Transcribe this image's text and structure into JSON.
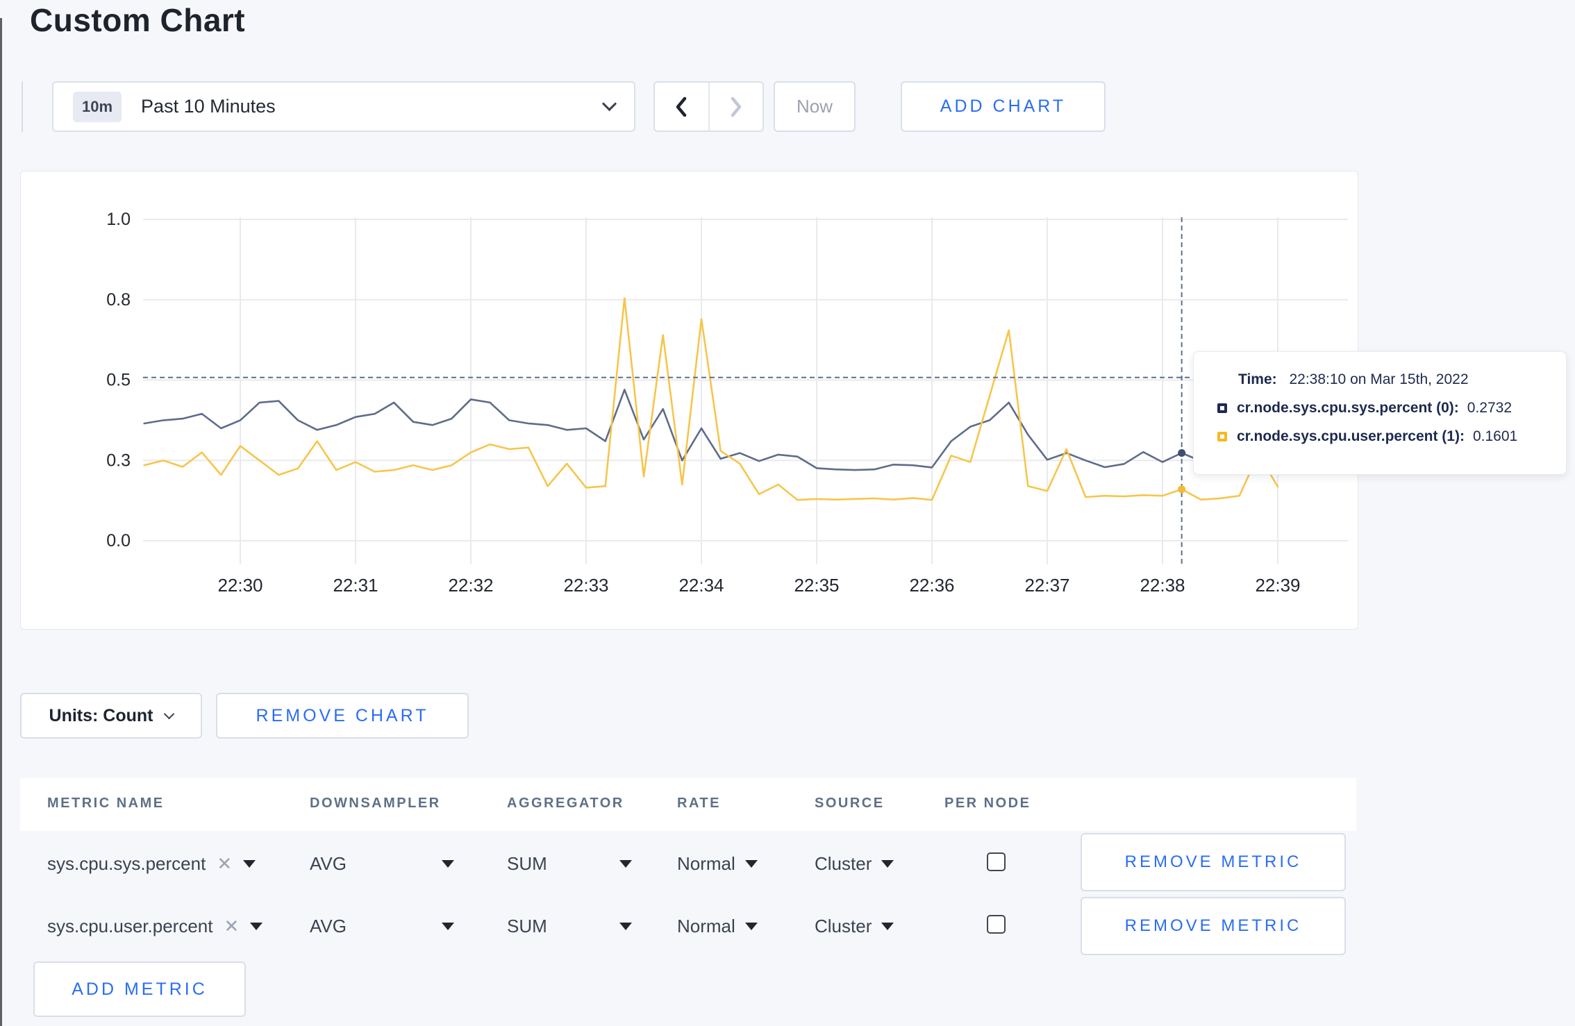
{
  "page_title": "Custom Chart",
  "colors": {
    "accent_blue": "#2a6df4",
    "series_sys": "#5e6c8a",
    "series_user": "#f6c64b",
    "tooltip_sys_square": "#1e2b52",
    "tooltip_user_square": "#f5b921",
    "crosshair": "#5d6f8a",
    "grid": "#e9eaee"
  },
  "toolbar": {
    "time_badge": "10m",
    "time_label": "Past 10 Minutes",
    "now_label": "Now",
    "add_chart_label": "ADD CHART"
  },
  "chart_data": {
    "type": "line",
    "title": "",
    "xlabel": "",
    "ylabel": "",
    "ylim": [
      0,
      1
    ],
    "grid": true,
    "legend_position": "tooltip",
    "x_ticks": [
      "22:30",
      "22:31",
      "22:32",
      "22:33",
      "22:34",
      "22:35",
      "22:36",
      "22:37",
      "22:38",
      "22:39"
    ],
    "y_ticks": [
      {
        "label": "0.0",
        "value": 0
      },
      {
        "label": "0.3",
        "value": 0.25
      },
      {
        "label": "0.5",
        "value": 0.5
      },
      {
        "label": "0.8",
        "value": 0.75
      },
      {
        "label": "1.0",
        "value": 1
      }
    ],
    "start_time": "22:29:10",
    "interval_seconds": 10,
    "x_start_minutes": -0.8333,
    "series": [
      {
        "name": "cr.node.sys.cpu.sys.percent",
        "color": "#5e6c8a",
        "values": [
          0.365,
          0.375,
          0.38,
          0.395,
          0.35,
          0.375,
          0.43,
          0.435,
          0.375,
          0.345,
          0.36,
          0.385,
          0.395,
          0.43,
          0.37,
          0.36,
          0.38,
          0.44,
          0.43,
          0.375,
          0.365,
          0.36,
          0.345,
          0.35,
          0.31,
          0.47,
          0.315,
          0.41,
          0.25,
          0.35,
          0.255,
          0.273,
          0.248,
          0.268,
          0.262,
          0.226,
          0.222,
          0.22,
          0.222,
          0.237,
          0.235,
          0.228,
          0.31,
          0.355,
          0.375,
          0.43,
          0.33,
          0.252,
          0.273,
          0.25,
          0.229,
          0.239,
          0.276,
          0.245,
          0.2732,
          0.248,
          0.26,
          0.27,
          0.26,
          0.25
        ]
      },
      {
        "name": "cr.node.sys.cpu.user.percent",
        "color": "#f6c64b",
        "values": [
          0.235,
          0.25,
          0.23,
          0.275,
          0.205,
          0.295,
          0.25,
          0.205,
          0.225,
          0.31,
          0.22,
          0.245,
          0.215,
          0.22,
          0.235,
          0.22,
          0.235,
          0.275,
          0.3,
          0.285,
          0.29,
          0.17,
          0.24,
          0.165,
          0.17,
          0.755,
          0.2,
          0.64,
          0.175,
          0.69,
          0.28,
          0.24,
          0.145,
          0.175,
          0.127,
          0.13,
          0.128,
          0.13,
          0.132,
          0.128,
          0.133,
          0.127,
          0.265,
          0.245,
          0.45,
          0.655,
          0.17,
          0.155,
          0.285,
          0.136,
          0.14,
          0.138,
          0.142,
          0.14,
          0.1601,
          0.128,
          0.132,
          0.14,
          0.27,
          0.168
        ]
      }
    ],
    "crosshair": {
      "time": "22:38:10",
      "x_minutes": 8.1667,
      "y_value": 0.508,
      "points": [
        {
          "series": "cr.node.sys.cpu.sys.percent",
          "value": 0.2732,
          "color": "#3e4f74"
        },
        {
          "series": "cr.node.sys.cpu.user.percent",
          "value": 0.1601,
          "color": "#f2bc31"
        }
      ]
    }
  },
  "tooltip": {
    "time_label": "Time:",
    "time_value": "22:38:10 on Mar 15th, 2022",
    "series": [
      {
        "label": "cr.node.sys.cpu.sys.percent (0):",
        "value": "0.2732",
        "color": "#1e2b52"
      },
      {
        "label": "cr.node.sys.cpu.user.percent (1):",
        "value": "0.1601",
        "color": "#f5b921"
      }
    ]
  },
  "chart_controls": {
    "units_label": "Units: Count",
    "remove_chart_label": "REMOVE CHART"
  },
  "metrics_table": {
    "headers": [
      "METRIC NAME",
      "DOWNSAMPLER",
      "AGGREGATOR",
      "RATE",
      "SOURCE",
      "PER NODE"
    ],
    "rows": [
      {
        "metric": "sys.cpu.sys.percent",
        "downsampler": "AVG",
        "aggregator": "SUM",
        "rate": "Normal",
        "source": "Cluster",
        "per_node_checked": false,
        "remove_label": "REMOVE METRIC"
      },
      {
        "metric": "sys.cpu.user.percent",
        "downsampler": "AVG",
        "aggregator": "SUM",
        "rate": "Normal",
        "source": "Cluster",
        "per_node_checked": false,
        "remove_label": "REMOVE METRIC"
      }
    ],
    "add_metric_label": "ADD METRIC"
  }
}
